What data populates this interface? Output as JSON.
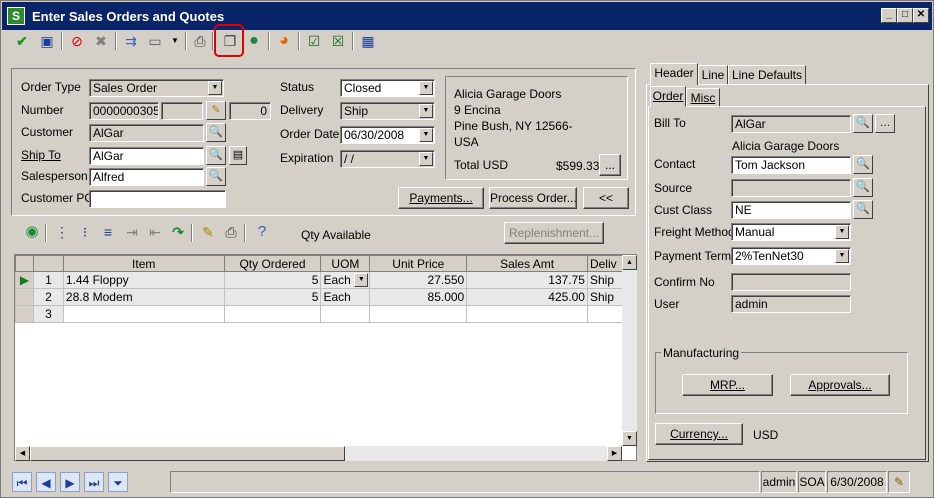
{
  "window": {
    "title": "Enter Sales Orders and Quotes",
    "app_icon": "S"
  },
  "toolbar": {
    "icons": [
      "accept-icon",
      "save-icon",
      "delete-icon",
      "cancel-icon",
      "copy-from-icon",
      "template-icon",
      "print-icon",
      "copy-icon",
      "help-icon",
      "color-icon",
      "check-icon",
      "edit-icon",
      "calendar-icon"
    ]
  },
  "order": {
    "type_label": "Order Type",
    "type_value": "Sales Order",
    "number_label": "Number",
    "number_value": "0000000305",
    "number_extra": "0",
    "customer_label": "Customer",
    "customer_value": "AlGar",
    "shipto_label": "Ship To",
    "shipto_value": "AlGar",
    "salesperson_label": "Salesperson",
    "salesperson_value": "Alfred",
    "customerpo_label": "Customer PO",
    "customerpo_value": "",
    "status_label": "Status",
    "status_value": "Closed",
    "delivery_label": "Delivery",
    "delivery_value": "Ship",
    "orderdate_label": "Order Date",
    "orderdate_value": "06/30/2008",
    "expiration_label": "Expiration",
    "expiration_value": " /  /"
  },
  "address": {
    "line1": "Alicia Garage Doors",
    "line2": "9 Encina",
    "line3": "Pine Bush, NY  12566-",
    "line4": "USA",
    "total_label": "Total  USD",
    "total_value": "$599.33",
    "more": "..."
  },
  "buttons": {
    "payments": "Payments...",
    "process": "Process Order...",
    "collapse": "<<",
    "replenishment": "Replenishment...",
    "mrp": "MRP...",
    "approvals": "Approvals...",
    "currency": "Currency..."
  },
  "lines_toolbar": {
    "qty_available": "Qty Available"
  },
  "grid": {
    "columns": [
      "",
      "",
      "Item",
      "Qty Ordered",
      "UOM",
      "Unit Price",
      "Sales Amt",
      "Deliv"
    ],
    "rows": [
      {
        "num": "1",
        "item": "1.44 Floppy",
        "qty": "5",
        "uom": "Each",
        "price": "27.550",
        "amt": "137.75",
        "deliv": "Ship"
      },
      {
        "num": "2",
        "item": "28.8 Modem",
        "qty": "5",
        "uom": "Each",
        "price": "85.000",
        "amt": "425.00",
        "deliv": "Ship"
      },
      {
        "num": "3",
        "item": "",
        "qty": "",
        "uom": "",
        "price": "",
        "amt": "",
        "deliv": ""
      }
    ]
  },
  "tabs": {
    "header": "Header",
    "line": "Line",
    "line_defaults": "Line Defaults",
    "order": "Order",
    "misc": "Misc"
  },
  "header": {
    "billto_label": "Bill To",
    "billto_value": "AlGar",
    "billto_name": "Alicia Garage Doors",
    "contact_label": "Contact",
    "contact_value": "Tom Jackson",
    "source_label": "Source",
    "source_value": "",
    "custclass_label": "Cust Class",
    "custclass_value": "NE",
    "freight_label": "Freight Method",
    "freight_value": "Manual",
    "payterms_label": "Payment Terms",
    "payterms_value": "2%TenNet30",
    "confirm_label": "Confirm No",
    "confirm_value": "",
    "user_label": "User",
    "user_value": "admin",
    "manufacturing_label": "Manufacturing",
    "currency_value": "USD"
  },
  "status": {
    "message": "",
    "user": "admin",
    "company": "SOA",
    "date": "6/30/2008"
  }
}
